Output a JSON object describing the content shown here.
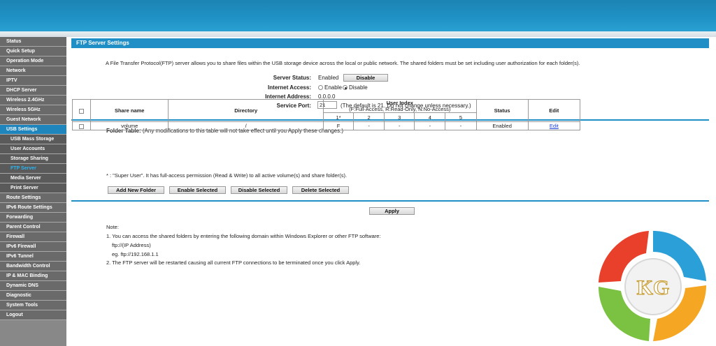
{
  "sidebar": {
    "items": [
      {
        "label": "Status",
        "type": "top"
      },
      {
        "label": "Quick Setup",
        "type": "top"
      },
      {
        "label": "Operation Mode",
        "type": "top"
      },
      {
        "label": "Network",
        "type": "top"
      },
      {
        "label": "IPTV",
        "type": "top"
      },
      {
        "label": "DHCP Server",
        "type": "top"
      },
      {
        "label": "Wireless 2.4GHz",
        "type": "top"
      },
      {
        "label": "Wireless 5GHz",
        "type": "top"
      },
      {
        "label": "Guest Network",
        "type": "top"
      },
      {
        "label": "USB Settings",
        "type": "parent-active"
      },
      {
        "label": "USB Mass Storage",
        "type": "sub"
      },
      {
        "label": "User Accounts",
        "type": "sub"
      },
      {
        "label": "Storage Sharing",
        "type": "sub"
      },
      {
        "label": "FTP Server",
        "type": "sub-active"
      },
      {
        "label": "Media Server",
        "type": "sub"
      },
      {
        "label": "Print Server",
        "type": "sub"
      },
      {
        "label": "Route Settings",
        "type": "top"
      },
      {
        "label": "IPv6 Route Settings",
        "type": "top"
      },
      {
        "label": "Forwarding",
        "type": "top"
      },
      {
        "label": "Parent Control",
        "type": "top"
      },
      {
        "label": "Firewall",
        "type": "top"
      },
      {
        "label": "IPv6 Firewall",
        "type": "top"
      },
      {
        "label": "IPv6 Tunnel",
        "type": "top"
      },
      {
        "label": "Bandwidth Control",
        "type": "top"
      },
      {
        "label": "IP & MAC Binding",
        "type": "top"
      },
      {
        "label": "Dynamic DNS",
        "type": "top"
      },
      {
        "label": "Diagnostic",
        "type": "top"
      },
      {
        "label": "System Tools",
        "type": "top"
      },
      {
        "label": "Logout",
        "type": "top"
      }
    ]
  },
  "page": {
    "title": "FTP Server Settings",
    "intro": "A File Transfer Protocol(FTP) server allows you to share files within the USB storage device across the local or public network. The shared folders must be set including user authorization for each folder(s).",
    "server_status_label": "Server Status:",
    "server_status_value": "Enabled",
    "disable_button": "Disable",
    "internet_access_label": "Internet Access:",
    "enable_option": "Enable",
    "disable_option": "Disable",
    "internet_access_selected": "Disable",
    "internet_address_label": "Internet Address:",
    "internet_address_value": "0.0.0.0",
    "service_port_label": "Service Port:",
    "service_port_value": "21",
    "service_port_hint": "(The default is 21. Do not change unless necessary.)"
  },
  "folder_table": {
    "label": "Folder Table:",
    "hint": "(Any modifications to this table will not take effect until you Apply these changes.)",
    "headers": {
      "share_name": "Share name",
      "directory": "Directory",
      "user_index": "User Index",
      "user_index_sub": "(F:Full-Access, R:Read-Only, N:No-Access)",
      "status": "Status",
      "edit": "Edit"
    },
    "user_columns": [
      "1*",
      "2",
      "3",
      "4",
      "5"
    ],
    "rows": [
      {
        "share_name": "volume",
        "directory": "/",
        "users": [
          "F",
          "-",
          "-",
          "-",
          "-"
        ],
        "status": "Enabled",
        "edit": "Edit"
      }
    ],
    "footnote": "* : \"Super User\". It has full-access permission (Read & Write) to all active volume(s) and share folder(s).",
    "buttons": {
      "add": "Add New Folder",
      "enable": "Enable Selected",
      "disable": "Disable Selected",
      "delete": "Delete Selected"
    }
  },
  "apply_button": "Apply",
  "notes": {
    "title": "Note:",
    "line1": "1.  You can access the shared folders by entering the following domain within Windows Explorer or other FTP software:",
    "line1a": "ftp://(IP Address)",
    "line1b": "eg. ftp://192.168.1.1",
    "line2": "2.  The FTP server will be restarted causing all current FTP connections to be terminated once you click Apply."
  },
  "watermark": {
    "text": "KG",
    "colors": [
      "#e8402a",
      "#2b9fd8",
      "#7cc242",
      "#f5a623"
    ]
  }
}
